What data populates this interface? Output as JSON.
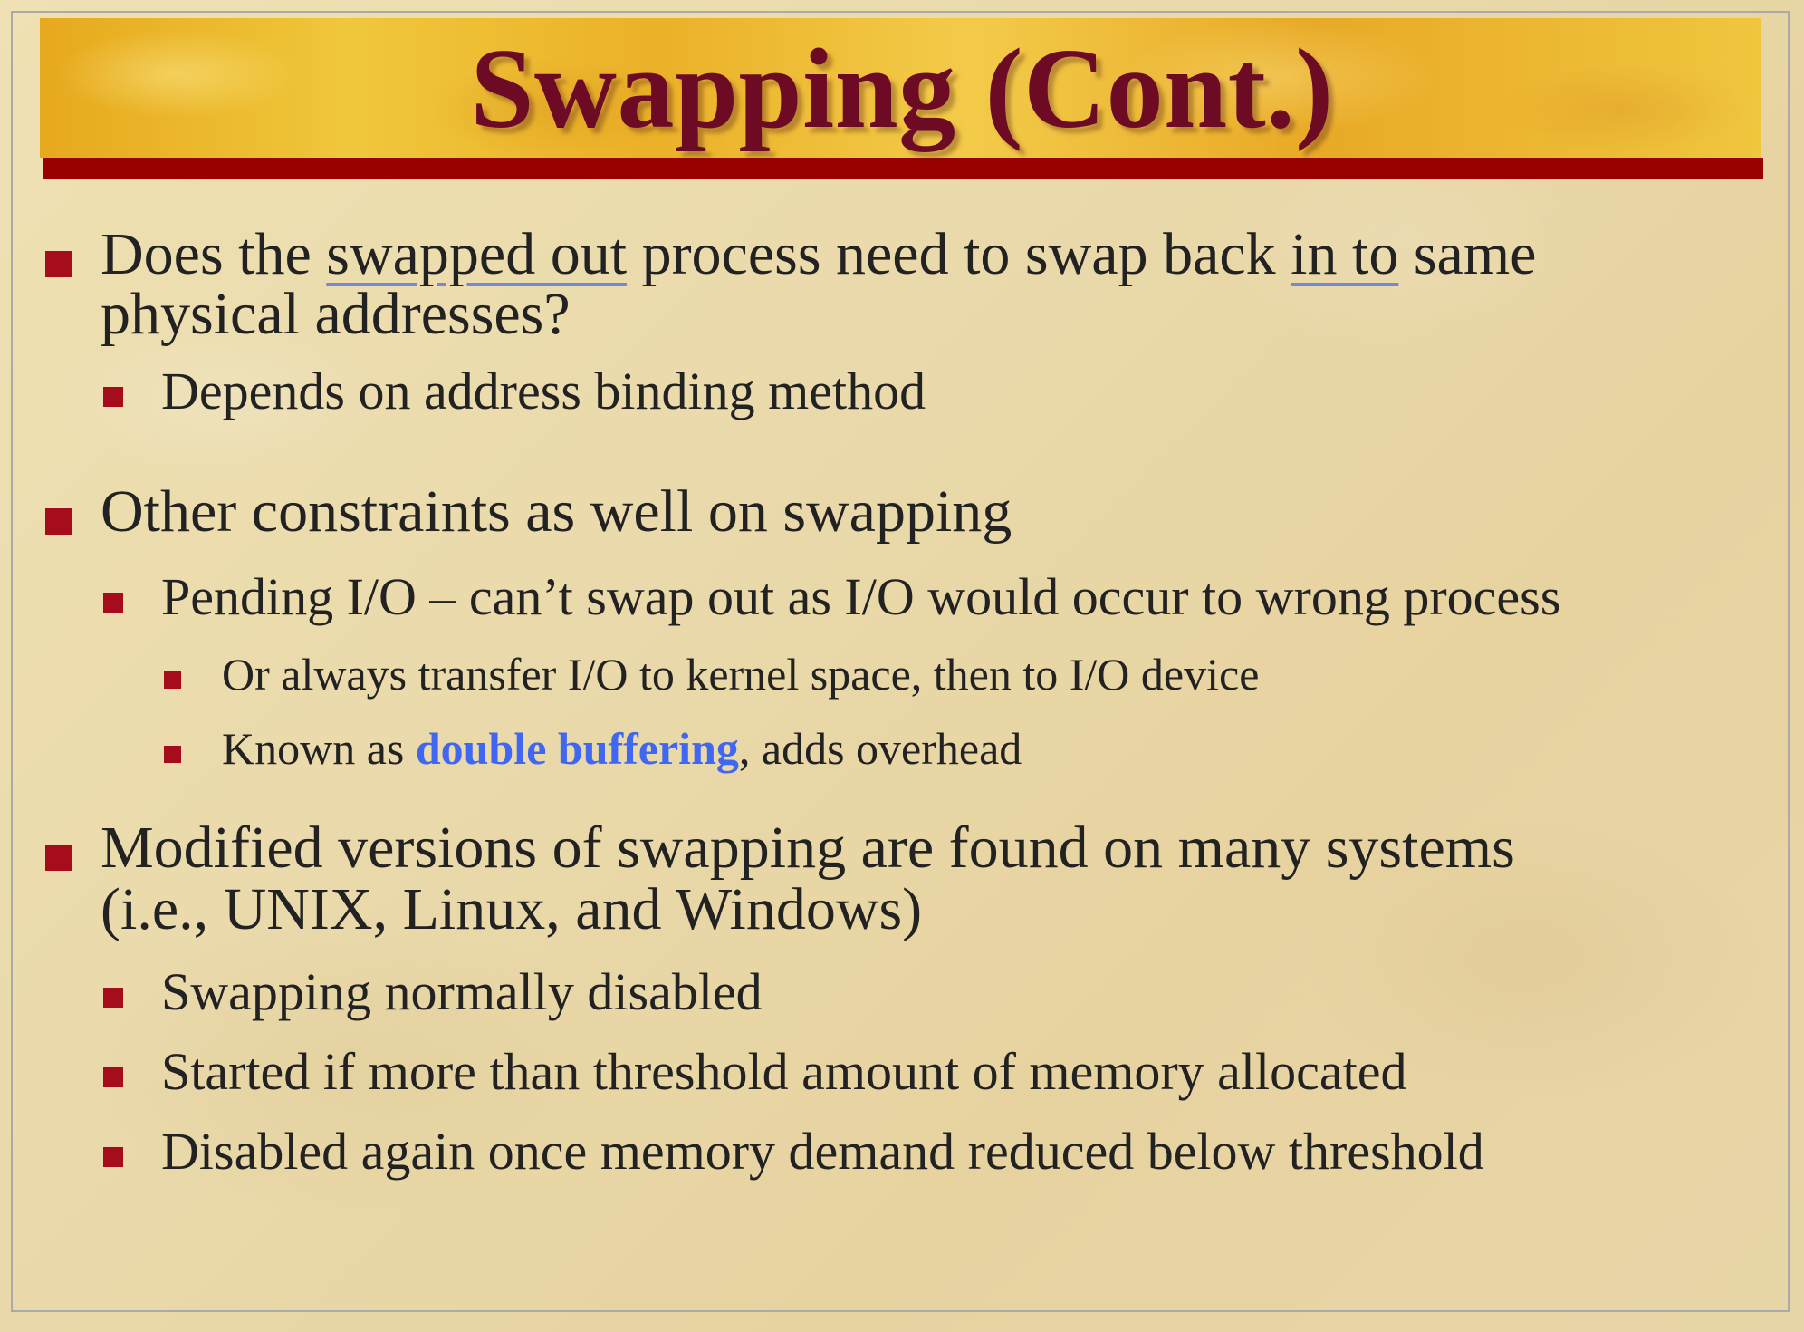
{
  "slide": {
    "title": "Swapping (Cont.)",
    "b1": {
      "prefix": "Does the ",
      "link1": "swapped out",
      "middle": " process need to swap back ",
      "link2": "in to",
      "suffix": " same",
      "line2": "physical addresses?"
    },
    "b1_1": "Depends on address binding method",
    "b2": "Other constraints as well on swapping",
    "b2_1": "Pending I/O – can’t swap out as I/O would occur to wrong process",
    "b2_1_1": "Or always transfer I/O to kernel space, then to I/O device",
    "b2_1_2": {
      "prefix": "Known as ",
      "highlight": "double buffering",
      "suffix": ", adds overhead"
    },
    "b3": {
      "line1": "Modified versions of swapping are found on many systems",
      "line2": "(i.e., UNIX, Linux, and Windows)"
    },
    "b3_1": "Swapping normally disabled",
    "b3_2": "Started if more than threshold amount of memory allocated",
    "b3_3": "Disabled again once memory demand reduced below threshold"
  },
  "colors": {
    "title": "#6d0b24",
    "header_rule": "#990000",
    "bullet": "#a50d1c",
    "text": "#222222",
    "highlight": "#3f67f2"
  }
}
